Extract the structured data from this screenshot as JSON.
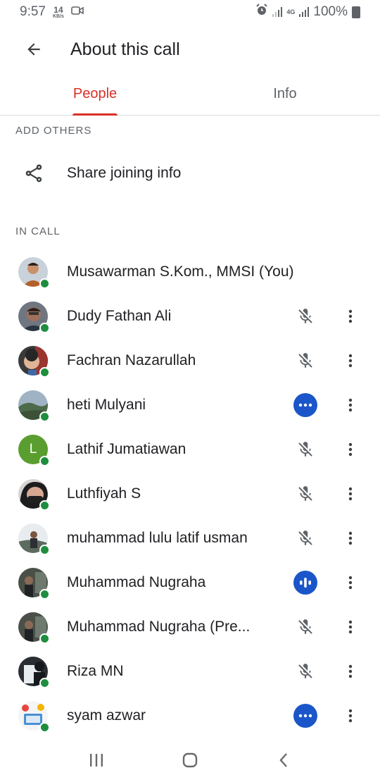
{
  "status_bar": {
    "time": "9:57",
    "net_speed_value": "14",
    "net_speed_unit": "KB/s",
    "network_label": "4G",
    "battery": "100%"
  },
  "header": {
    "title": "About this call",
    "back_icon": "arrow-left-icon"
  },
  "tabs": [
    {
      "label": "People",
      "active": true
    },
    {
      "label": "Info",
      "active": false
    }
  ],
  "add_others": {
    "section_label": "ADD OTHERS",
    "share_label": "Share joining info",
    "share_icon": "share-icon"
  },
  "in_call": {
    "section_label": "IN CALL",
    "participants": [
      {
        "name": "Musawarman S.Kom., MMSI (You)",
        "status": "none",
        "is_you": true
      },
      {
        "name": "Dudy Fathan Ali",
        "status": "muted"
      },
      {
        "name": "Fachran Nazarullah",
        "status": "muted"
      },
      {
        "name": "heti Mulyani",
        "status": "more-active"
      },
      {
        "name": "Lathif Jumatiawan",
        "status": "muted",
        "initial": "L",
        "avatar_color": "#5a9e2f"
      },
      {
        "name": "Luthfiyah S",
        "status": "muted"
      },
      {
        "name": "muhammad lulu latif usman",
        "status": "muted"
      },
      {
        "name": "Muhammad Nugraha",
        "status": "speaking"
      },
      {
        "name": "Muhammad Nugraha (Pre...",
        "status": "muted"
      },
      {
        "name": "Riza MN",
        "status": "muted"
      },
      {
        "name": "syam azwar",
        "status": "more-active"
      }
    ]
  },
  "colors": {
    "accent": "#d93025",
    "online": "#1e8e3e",
    "active_status": "#1a56c9"
  }
}
